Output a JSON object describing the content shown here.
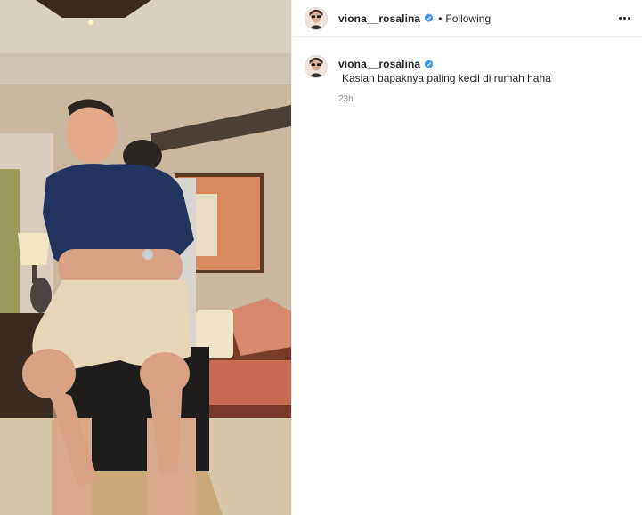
{
  "post": {
    "author": "viona__rosalina",
    "follow_status": "Following",
    "separator": "•"
  },
  "caption": {
    "author": "viona__rosalina",
    "text": "Kasian bapaknya paling kecil di rumah haha",
    "time": "23h"
  },
  "icons": {
    "verified": "verified-badge-icon",
    "more": "more-options-icon"
  },
  "colors": {
    "verified_blue": "#3897f0",
    "text": "#262626",
    "muted": "#8e8e8e",
    "border": "#efefef"
  }
}
